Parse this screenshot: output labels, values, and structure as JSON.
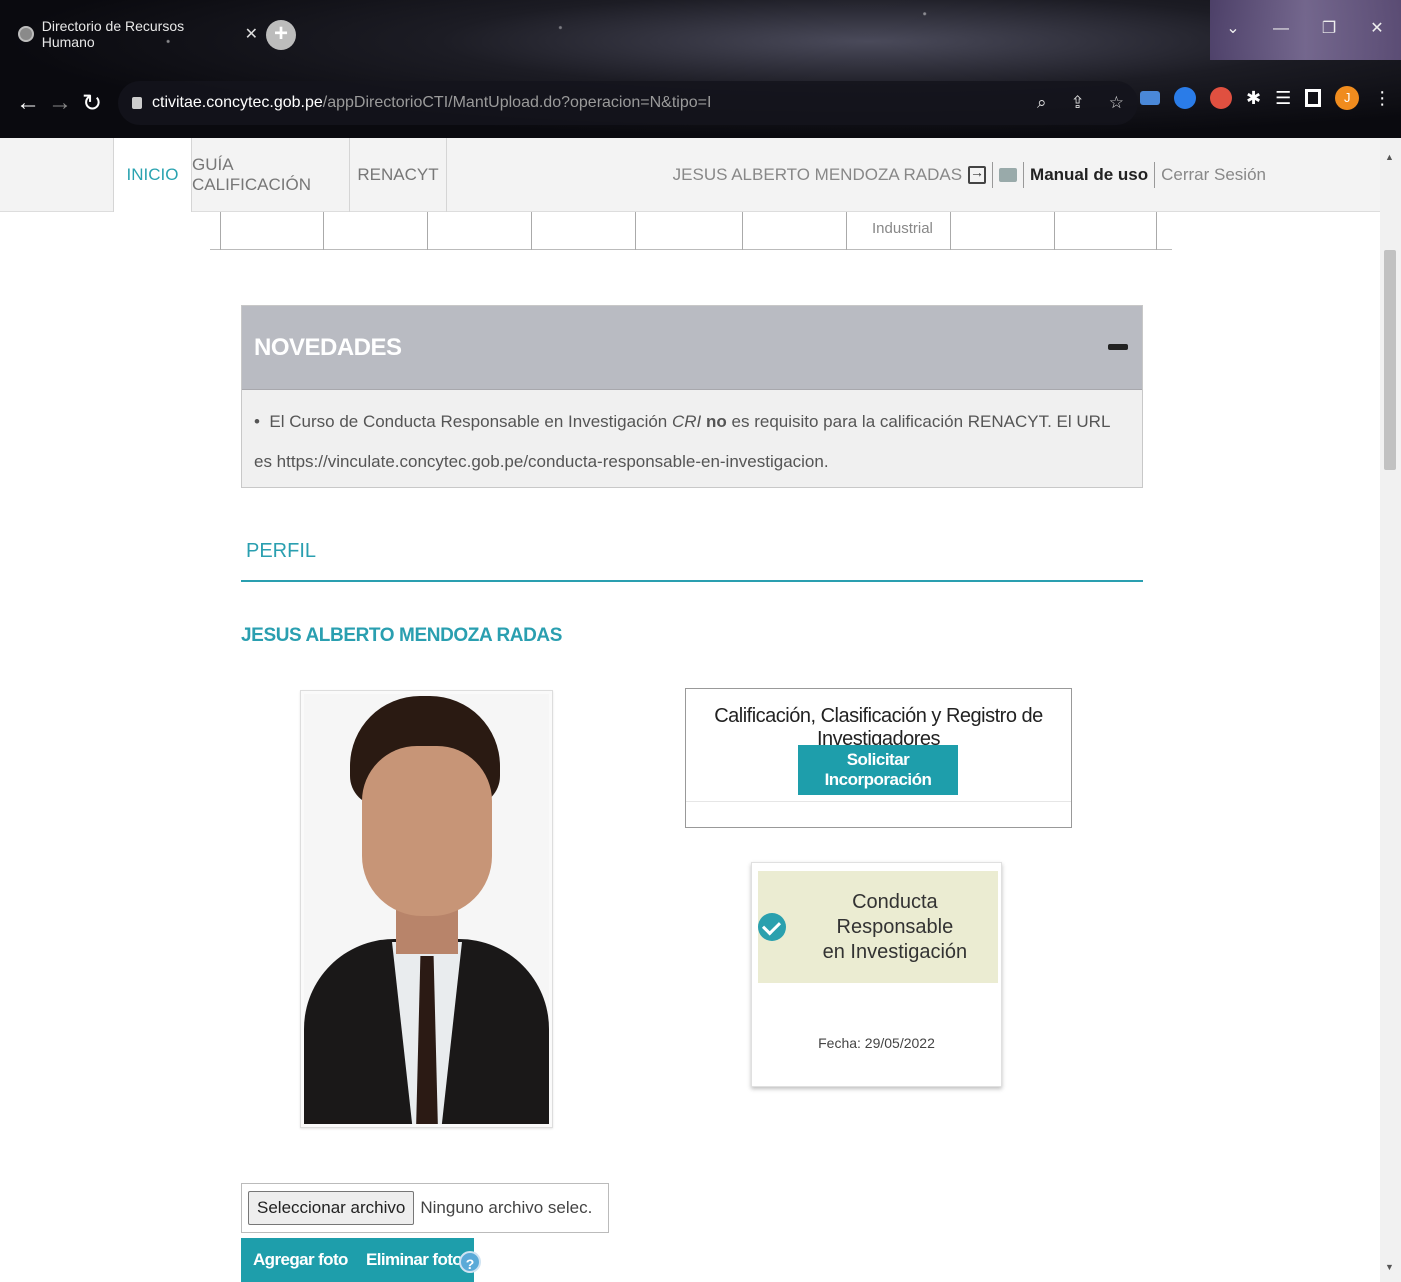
{
  "browser": {
    "tab_title": "Directorio de Recursos Humano",
    "tab_close": "✕",
    "new_tab": "+",
    "url_host": "ctivitae.concytec.gob.pe",
    "url_path": "/appDirectorioCTI/MantUpload.do?operacion=N&tipo=I",
    "profile_initial": "J",
    "window_controls": [
      "⌄",
      "—",
      "❐",
      "✕"
    ]
  },
  "sitenav": {
    "tabs": [
      {
        "label": "INICIO",
        "active": true
      },
      {
        "label": "GUÍA CALIFICACIÓN",
        "active": false
      },
      {
        "label": "RENACYT",
        "active": false
      }
    ],
    "user": "JESUS ALBERTO MENDOZA RADAS",
    "manual_label": "Manual de uso",
    "logout_label": "Cerrar Sesión"
  },
  "subtabs": {
    "visible_label": "Industrial"
  },
  "novedades": {
    "title": "NOVEDADES",
    "text_prefix": "El Curso de Conducta Responsable en Investigación ",
    "text_italic": "CRI",
    "text_bold": "no",
    "text_suffix": " es requisito para la calificación RENACYT. El URL es https://vinculate.concytec.gob.pe/conducta-responsable-en-investigacion."
  },
  "perfil": {
    "section_title": "PERFIL",
    "user_name": "JESUS ALBERTO MENDOZA RADAS"
  },
  "calificacion": {
    "title": "Calificación, Clasificación y Registro de Investigadores",
    "button_label": "Solicitar Incorporación"
  },
  "cri_badge": {
    "line1": "Conducta Responsable",
    "line2": "en Investigación",
    "date_text": "Fecha: 29/05/2022"
  },
  "foto": {
    "file_button": "Seleccionar archivo",
    "file_status": "Ninguno archivo selec.",
    "add_label": "Agregar foto",
    "remove_label": "Eliminar foto",
    "help_glyph": "?"
  },
  "colors": {
    "accent": "#2a9fb0",
    "button": "#1e9eab",
    "panel_header": "#b9bbc2",
    "cri_badge_bg": "#ebecd2"
  }
}
